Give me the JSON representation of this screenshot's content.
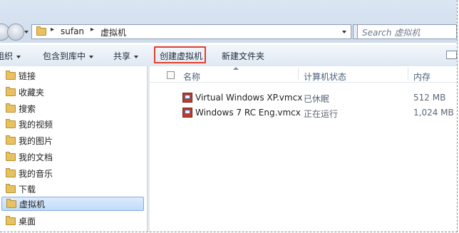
{
  "address": {
    "crumbs": [
      "sufan",
      "虚拟机"
    ],
    "search_placeholder": "Search 虚拟机"
  },
  "toolbar": {
    "organize_label": "组织",
    "include_label": "包含到库中",
    "share_label": "共享",
    "create_vm_label": "创建虚拟机",
    "new_folder_label": "新建文件夹"
  },
  "nav": {
    "items": [
      {
        "label": "链接",
        "icon": "link-folder-icon"
      },
      {
        "label": "收藏夹",
        "icon": "favorites-folder-icon"
      },
      {
        "label": "搜索",
        "icon": "search-folder-icon"
      },
      {
        "label": "我的视频",
        "icon": "videos-folder-icon"
      },
      {
        "label": "我的图片",
        "icon": "pictures-folder-icon"
      },
      {
        "label": "我的文档",
        "icon": "documents-folder-icon"
      },
      {
        "label": "我的音乐",
        "icon": "music-folder-icon"
      },
      {
        "label": "下载",
        "icon": "downloads-folder-icon"
      },
      {
        "label": "虚拟机",
        "icon": "virtual-machines-folder-icon",
        "selected": true
      },
      {
        "label": "桌面",
        "icon": "desktop-folder-icon"
      }
    ]
  },
  "columns": {
    "name": "名称",
    "status": "计算机状态",
    "memory": "内存"
  },
  "files": [
    {
      "name": "Virtual Windows XP.vmcx",
      "status": "已休眠",
      "memory": "512 MB"
    },
    {
      "name": "Windows 7 RC Eng.vmcx",
      "status": "正在运行",
      "memory": "1,024 MB"
    }
  ],
  "colors": {
    "highlight_border": "#e0412f",
    "selected_bg": "#c1dbfa"
  }
}
